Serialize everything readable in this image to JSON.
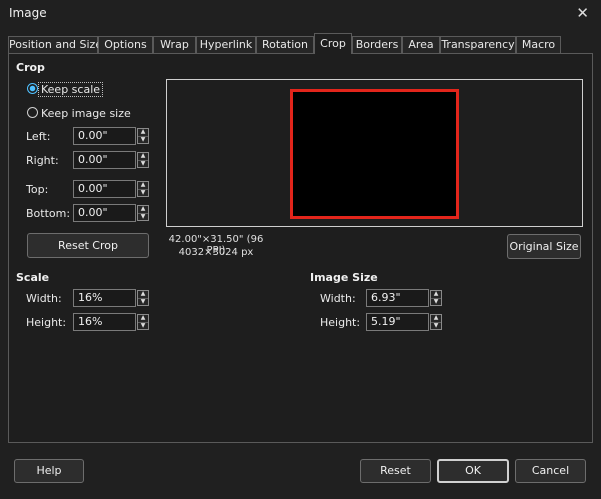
{
  "window": {
    "title": "Image",
    "close_glyph": "✕"
  },
  "tabs": [
    {
      "label": "Position and Size",
      "active": false
    },
    {
      "label": "Options",
      "active": false
    },
    {
      "label": "Wrap",
      "active": false
    },
    {
      "label": "Hyperlink",
      "active": false
    },
    {
      "label": "Rotation",
      "active": false
    },
    {
      "label": "Crop",
      "active": true
    },
    {
      "label": "Borders",
      "active": false
    },
    {
      "label": "Area",
      "active": false
    },
    {
      "label": "Transparency",
      "active": false
    },
    {
      "label": "Macro",
      "active": false
    }
  ],
  "crop": {
    "heading": "Crop",
    "keep_scale_label": "Keep scale",
    "keep_scale_checked": true,
    "keep_image_size_label": "Keep image size",
    "keep_image_size_checked": false,
    "left_label": "Left:",
    "left_value": "0.00\"",
    "right_label": "Right:",
    "right_value": "0.00\"",
    "top_label": "Top:",
    "top_value": "0.00\"",
    "bottom_label": "Bottom:",
    "bottom_value": "0.00\"",
    "reset_crop_label": "Reset Crop"
  },
  "preview": {
    "dimensions_text": "42.00\"×31.50\" (96 PPI)",
    "pixels_text": "4032×3024 px",
    "original_size_label": "Original Size",
    "frame_color": "#e3251b"
  },
  "scale": {
    "heading": "Scale",
    "width_label": "Width:",
    "width_value": "16%",
    "height_label": "Height:",
    "height_value": "16%"
  },
  "image_size": {
    "heading": "Image Size",
    "width_label": "Width:",
    "width_value": "6.93\"",
    "height_label": "Height:",
    "height_value": "5.19\""
  },
  "footer": {
    "help_label": "Help",
    "reset_label": "Reset",
    "ok_label": "OK",
    "cancel_label": "Cancel"
  },
  "colors": {
    "accent": "#4fc1ff",
    "background": "#202020"
  }
}
